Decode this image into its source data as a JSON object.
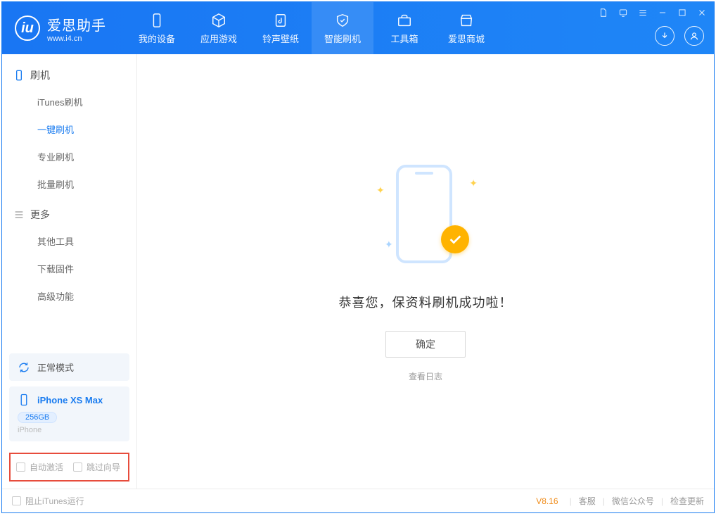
{
  "app": {
    "title": "爱思助手",
    "subtitle": "www.i4.cn"
  },
  "tabs": {
    "device": "我的设备",
    "apps": "应用游戏",
    "ringtones": "铃声壁纸",
    "flash": "智能刷机",
    "toolbox": "工具箱",
    "store": "爱思商城"
  },
  "sidebar": {
    "group1": "刷机",
    "items1": {
      "itunes": "iTunes刷机",
      "oneclick": "一键刷机",
      "pro": "专业刷机",
      "batch": "批量刷机"
    },
    "group2": "更多",
    "items2": {
      "othertools": "其他工具",
      "firmware": "下载固件",
      "advanced": "高级功能"
    }
  },
  "device": {
    "mode": "正常模式",
    "name": "iPhone XS Max",
    "capacity": "256GB",
    "type": "iPhone"
  },
  "options": {
    "autoActivate": "自动激活",
    "skipGuide": "跳过向导"
  },
  "main": {
    "success": "恭喜您，保资料刷机成功啦！",
    "ok": "确定",
    "viewLog": "查看日志"
  },
  "footer": {
    "blockItunes": "阻止iTunes运行",
    "version": "V8.16",
    "support": "客服",
    "wechat": "微信公众号",
    "update": "检查更新"
  }
}
